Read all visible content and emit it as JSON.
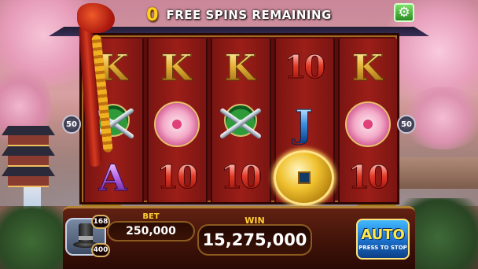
{
  "header": {
    "free_spins_count": "0",
    "free_spins_label": "FREE SPINS REMAINING"
  },
  "paylines": {
    "left": "50",
    "right": "50"
  },
  "reels": [
    [
      {
        "kind": "letter",
        "text": "K"
      },
      {
        "kind": "swords",
        "text": ""
      },
      {
        "kind": "a",
        "text": "A"
      }
    ],
    [
      {
        "kind": "letter",
        "text": "K"
      },
      {
        "kind": "flower",
        "text": ""
      },
      {
        "kind": "ten",
        "text": "10"
      }
    ],
    [
      {
        "kind": "letter",
        "text": "K"
      },
      {
        "kind": "swords",
        "text": ""
      },
      {
        "kind": "ten",
        "text": "10"
      }
    ],
    [
      {
        "kind": "ten",
        "text": "10"
      },
      {
        "kind": "j",
        "text": "J"
      },
      {
        "kind": "coin",
        "text": ""
      }
    ],
    [
      {
        "kind": "letter",
        "text": "K"
      },
      {
        "kind": "flower",
        "text": ""
      },
      {
        "kind": "ten",
        "text": "10"
      }
    ]
  ],
  "bonus": {
    "badge_top": "168",
    "badge_bottom": "400"
  },
  "bet": {
    "label": "BET",
    "value": "250,000"
  },
  "win": {
    "label": "WIN",
    "value": "15,275,000"
  },
  "auto": {
    "title": "AUTO",
    "subtitle": "PRESS TO STOP"
  },
  "colors": {
    "accent_gold": "#ffcf1a",
    "settings_green": "#2b8c22",
    "auto_blue": "#1b6fc9"
  }
}
